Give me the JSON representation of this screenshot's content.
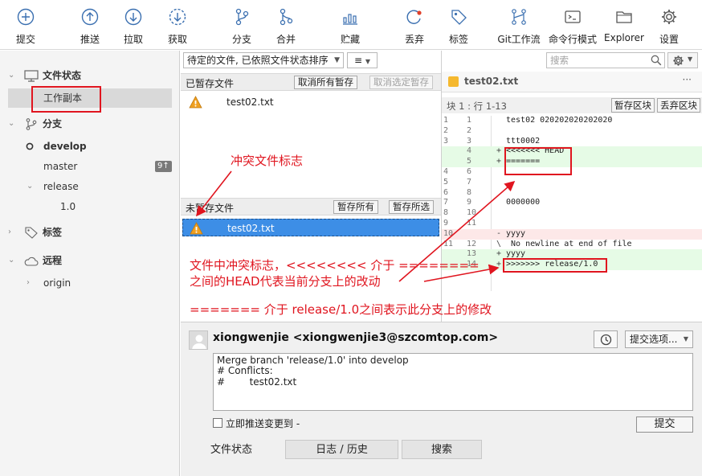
{
  "toolbar": {
    "items": [
      {
        "label": "提交",
        "icon": "plus-circle-icon"
      },
      {
        "label": "推送",
        "icon": "arrow-up-circle-icon"
      },
      {
        "label": "拉取",
        "icon": "arrow-down-circle-icon"
      },
      {
        "label": "获取",
        "icon": "fetch-circle-icon"
      },
      {
        "label": "分支",
        "icon": "branch-icon"
      },
      {
        "label": "合并",
        "icon": "merge-icon"
      },
      {
        "label": "贮藏",
        "icon": "stash-icon"
      },
      {
        "label": "丢弃",
        "icon": "discard-icon"
      },
      {
        "label": "标签",
        "icon": "tag-icon"
      },
      {
        "label": "Git工作流",
        "icon": "git-flow-icon"
      },
      {
        "label": "命令行模式",
        "icon": "terminal-icon"
      },
      {
        "label": "Explorer",
        "icon": "folder-icon"
      },
      {
        "label": "设置",
        "icon": "gear-icon"
      }
    ]
  },
  "sidebar": {
    "file_status": "文件状态",
    "working_copy": "工作副本",
    "branches": "分支",
    "develop": "develop",
    "master": "master",
    "master_badge": "9↑",
    "release": "release",
    "release_child": "1.0",
    "tags": "标签",
    "remote": "远程",
    "origin": "origin"
  },
  "files": {
    "sort_label": "待定的文件, 已依照文件状态排序",
    "view_icon": "≡",
    "staged_title": "已暂存文件",
    "unstage_all": "取消所有暂存",
    "unstage_selected": "取消选定暂存",
    "staged_file": "test02.txt",
    "unstaged_title": "未暂存文件",
    "stage_all": "暂存所有",
    "stage_selected": "暂存所选",
    "unstaged_file": "test02.txt"
  },
  "diff": {
    "search_placeholder": "搜索",
    "file_name": "test02.txt",
    "more": "···",
    "hunk_label": "块 1 : 行 1-13",
    "stage_hunk": "暂存区块",
    "discard_hunk": "丢弃区块",
    "lines": [
      {
        "o": "1",
        "n": "1",
        "m": "",
        "t": "test02 020202020202020",
        "k": ""
      },
      {
        "o": "2",
        "n": "2",
        "m": "",
        "t": "",
        "k": ""
      },
      {
        "o": "3",
        "n": "3",
        "m": "",
        "t": "ttt0002",
        "k": ""
      },
      {
        "o": "",
        "n": "4",
        "m": "+",
        "t": "<<<<<<< HEAD",
        "k": "add"
      },
      {
        "o": "",
        "n": "5",
        "m": "+",
        "t": "=======",
        "k": "add"
      },
      {
        "o": "4",
        "n": "6",
        "m": "",
        "t": "",
        "k": ""
      },
      {
        "o": "5",
        "n": "7",
        "m": "",
        "t": "",
        "k": ""
      },
      {
        "o": "6",
        "n": "8",
        "m": "",
        "t": "",
        "k": ""
      },
      {
        "o": "7",
        "n": "9",
        "m": "",
        "t": "0000000",
        "k": ""
      },
      {
        "o": "8",
        "n": "10",
        "m": "",
        "t": "",
        "k": ""
      },
      {
        "o": "9",
        "n": "11",
        "m": "",
        "t": "",
        "k": ""
      },
      {
        "o": "10",
        "n": "",
        "m": "-",
        "t": "yyyy",
        "k": "del"
      },
      {
        "o": "11",
        "n": "12",
        "m": "\\",
        "t": " No newline at end of file",
        "k": ""
      },
      {
        "o": "",
        "n": "13",
        "m": "+",
        "t": "yyyy",
        "k": "add"
      },
      {
        "o": "",
        "n": "14",
        "m": "+",
        "t": ">>>>>>> release/1.0",
        "k": "add"
      }
    ]
  },
  "commit": {
    "author": "xiongwenjie <xiongwenjie3@szcomtop.com>",
    "options": "提交选项...",
    "message_lines": [
      "Merge branch 'release/1.0' into develop",
      "",
      "# Conflicts:",
      "#        test02.txt"
    ],
    "push_label": "立即推送变更到 -",
    "submit": "提交"
  },
  "tabs": [
    "文件状态",
    "日志 / 历史",
    "搜索"
  ],
  "annotations": {
    "conflict_mark": "冲突文件标志",
    "explain_1": "文件中冲突标志，<<<<<<<< 介于 ========",
    "explain_2": "之间的HEAD代表当前分支上的改动",
    "explain_3": "======= 介于 release/1.0之间表示此分支上的修改"
  },
  "colors": {
    "accent": "#3d8ee6",
    "annotation": "#e0151f",
    "add_bg": "#e6fbe6",
    "del_bg": "#fde8e8"
  }
}
